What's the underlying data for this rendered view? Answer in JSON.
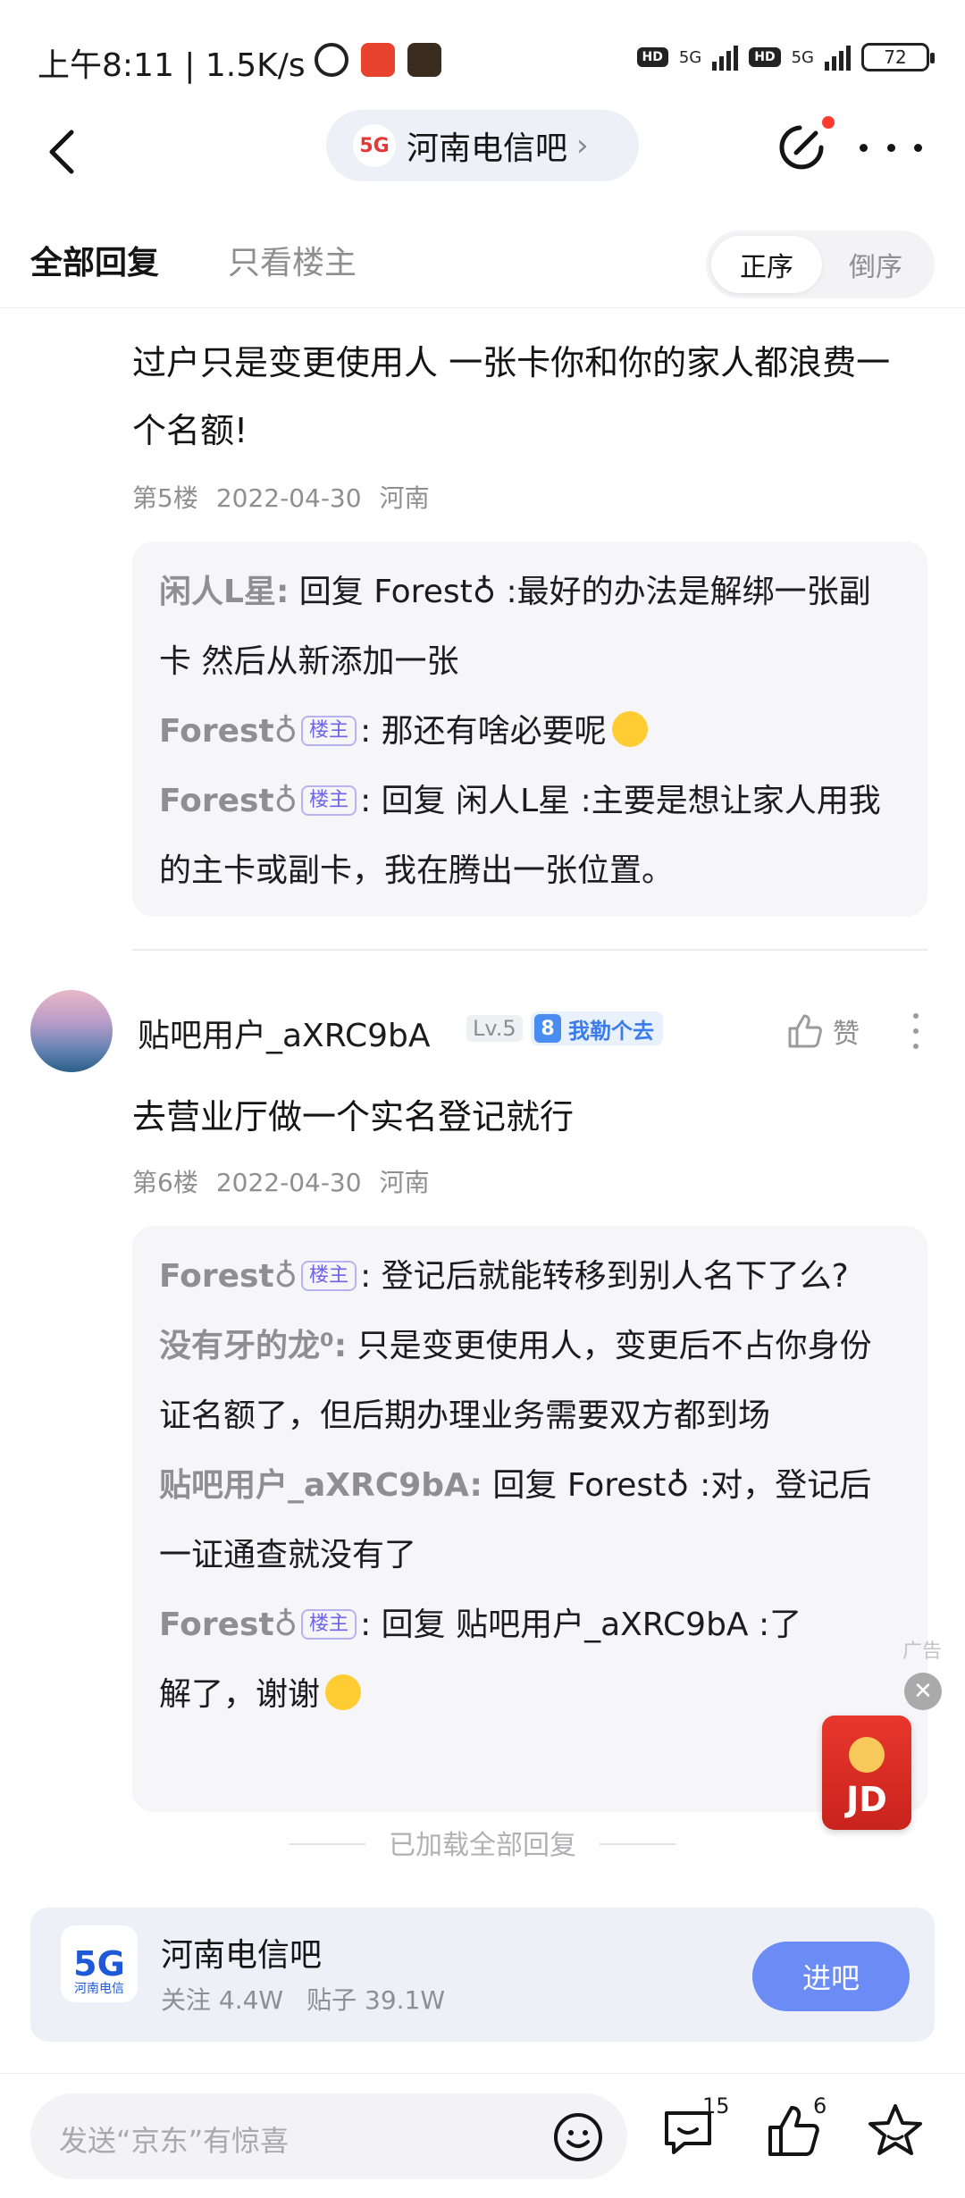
{
  "status_bar": {
    "time": "上午8:11 | 1.5K/s",
    "hd1": "HD",
    "net1": "5G",
    "hd2": "HD",
    "net2": "5G",
    "battery": "72"
  },
  "nav": {
    "forum_name": "河南电信吧",
    "logo_text": "5G"
  },
  "tabs": {
    "all": "全部回复",
    "owner_only": "只看楼主",
    "sort_asc": "正序",
    "sort_desc": "倒序"
  },
  "post5": {
    "text": "过户只是变更使用人 一张卡你和你的家人都浪费一个名额!",
    "floor": "第5楼",
    "date": "2022-04-30",
    "location": "河南",
    "replies": [
      {
        "who": "闲人L星:",
        "text": " 回复 Forest♁ :最好的办法是解绑一张副卡 然后从新添加一张"
      },
      {
        "who": "Forest♁",
        "tag": "楼主",
        "text": ": 那还有啥必要呢"
      },
      {
        "who": "Forest♁",
        "tag": "楼主",
        "text": ": 回复 闲人L星 :主要是想让家人用我的主卡或副卡，我在腾出一张位置。"
      }
    ]
  },
  "post6": {
    "username": "贴吧用户_aXRC9bA",
    "level": "Lv.5",
    "badge_num": "8",
    "badge_text": "我勒个去",
    "like_label": "赞",
    "text": "去营业厅做一个实名登记就行",
    "floor": "第6楼",
    "date": "2022-04-30",
    "location": "河南",
    "replies": [
      {
        "who": "Forest♁",
        "tag": "楼主",
        "text": ": 登记后就能转移到别人名下了么?"
      },
      {
        "who": "没有牙的龙⁰:",
        "text": " 只是变更使用人，变更后不占你身份证名额了，但后期办理业务需要双方都到场"
      },
      {
        "who": "贴吧用户_aXRC9bA:",
        "text": " 回复 Forest♁ :对，登记后一证通查就没有了"
      },
      {
        "who": "Forest♁",
        "tag": "楼主",
        "text": ": 回复 贴吧用户_aXRC9bA :了解了，谢谢"
      }
    ]
  },
  "loaded_text": "已加载全部回复",
  "ad": {
    "label": "广告",
    "close": "✕",
    "brand": "JD"
  },
  "forum_card": {
    "logo": "5G",
    "logo_sub": "河南电信",
    "name": "河南电信吧",
    "follow": "关注 4.4W",
    "posts": "贴子 39.1W",
    "join": "进吧"
  },
  "bottom_bar": {
    "placeholder": "发送“京东”有惊喜",
    "comment_count": "15",
    "like_count": "6"
  }
}
